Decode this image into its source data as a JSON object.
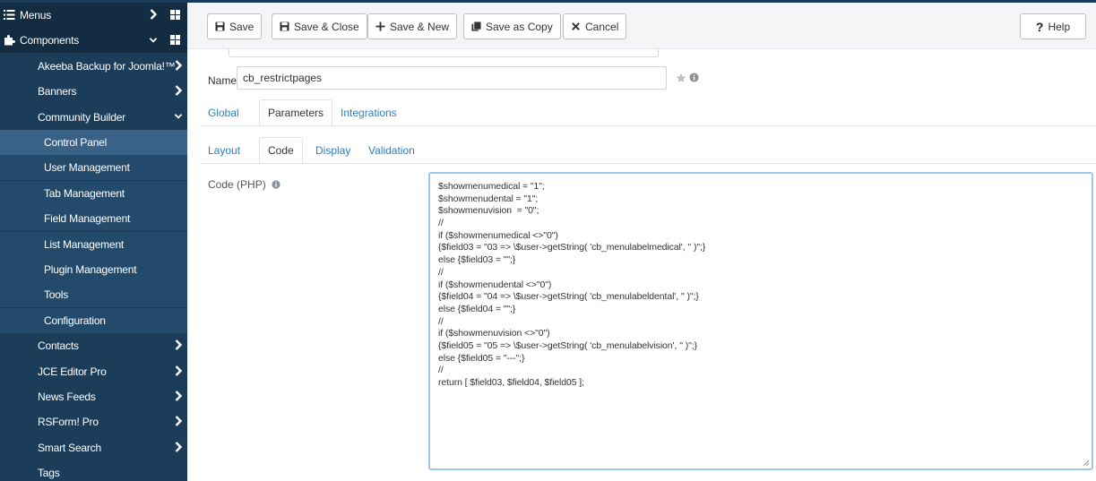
{
  "sidebar": {
    "items": [
      {
        "label": "Menus",
        "kind": "top",
        "icon": "list-icon",
        "chevron": "right",
        "grid": true
      },
      {
        "label": "Components",
        "kind": "top",
        "icon": "puzzle-icon",
        "chevron": "down",
        "grid": true
      },
      {
        "label": "Akeeba Backup for Joomla!™",
        "kind": "item",
        "chevron": "right"
      },
      {
        "label": "Banners",
        "kind": "item",
        "chevron": "right"
      },
      {
        "label": "Community Builder",
        "kind": "item",
        "chevron": "down"
      },
      {
        "label": "Control Panel",
        "kind": "sub-active"
      },
      {
        "label": "User Management",
        "kind": "sub"
      },
      {
        "label": "Tab Management",
        "kind": "sub"
      },
      {
        "label": "Field Management",
        "kind": "sub"
      },
      {
        "label": "List Management",
        "kind": "sub"
      },
      {
        "label": "Plugin Management",
        "kind": "sub"
      },
      {
        "label": "Tools",
        "kind": "sub"
      },
      {
        "label": "Configuration",
        "kind": "sub"
      },
      {
        "label": "Contacts",
        "kind": "item",
        "chevron": "right"
      },
      {
        "label": "JCE Editor Pro",
        "kind": "item",
        "chevron": "right"
      },
      {
        "label": "News Feeds",
        "kind": "item",
        "chevron": "right"
      },
      {
        "label": "RSForm! Pro",
        "kind": "item",
        "chevron": "right"
      },
      {
        "label": "Smart Search",
        "kind": "item",
        "chevron": "right"
      },
      {
        "label": "Tags",
        "kind": "item"
      }
    ]
  },
  "toolbar": {
    "save_label": "Save",
    "save_close_label": "Save & Close",
    "save_new_label": "Save & New",
    "save_copy_label": "Save as Copy",
    "cancel_label": "Cancel",
    "help_label": "Help"
  },
  "form": {
    "name_label": "Name",
    "name_value": "cb_restrictpages",
    "tabs": [
      "Global",
      "Parameters",
      "Integrations"
    ],
    "active_tab": "Parameters",
    "subtabs": [
      "Layout",
      "Code",
      "Display",
      "Validation"
    ],
    "active_subtab": "Code",
    "code_label": "Code (PHP)",
    "code_lines": [
      "$showmenumedical = \"1\";",
      "$showmenudental = \"1\";",
      "$showmenuvision  = \"0\";",
      "//",
      "if ($showmenumedical <>\"0\")",
      "{$field03 = \"03 => \\$user->getString( 'cb_menulabelmedical', '' )\";}",
      "else {$field03 = \"\";}",
      "//",
      "if ($showmenudental <>\"0\")",
      "{$field04 = \"04 => \\$user->getString( 'cb_menulabeldental', '' )\";}",
      "else {$field04 = \"\";}",
      "//",
      "if ($showmenuvision <>\"0\")",
      "{$field05 = \"05 => \\$user->getString( 'cb_menulabelvision', '' )\";}",
      "else {$field05 = \"---\";}",
      "//",
      "return [ $field03, $field04, $field05 ];"
    ]
  },
  "colors": {
    "sidebar_bg": "#1c3d5a",
    "sidebar_active": "#3a6286",
    "link_blue": "#2a7fc2",
    "focus_border": "#9fc6e8"
  }
}
